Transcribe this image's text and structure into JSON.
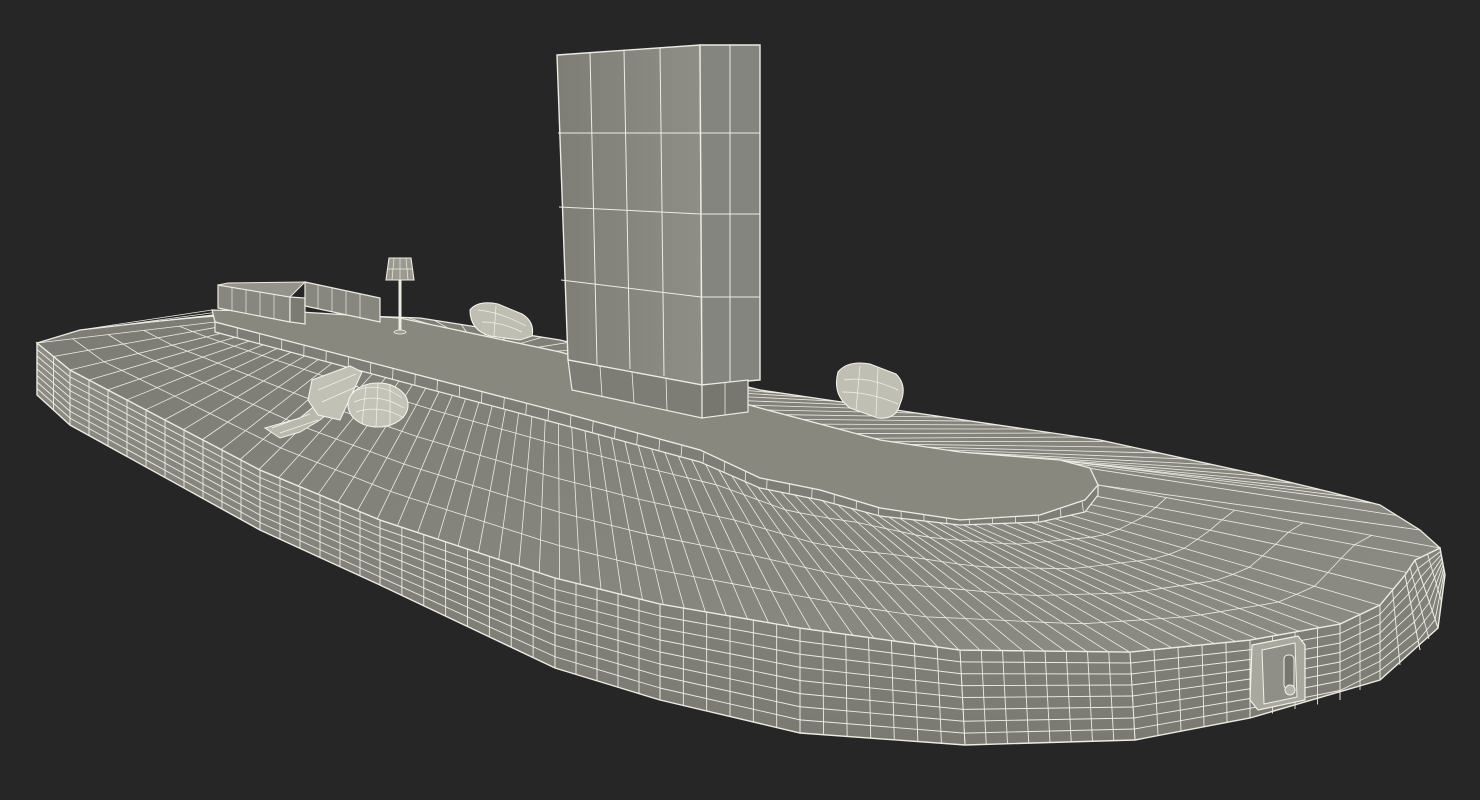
{
  "scene": {
    "subject": "baggage-carousel-wireframe",
    "render_style": "clay-wireframe",
    "colors": {
      "background": "#262626",
      "surface": "#8f8f86",
      "surface_light": "#a2a298",
      "surface_dark": "#76766e",
      "wire": "#ecece4",
      "highlight": "#f2f2ea"
    },
    "objects": [
      "outer-carousel-wall",
      "conveyor-plates",
      "inner-island",
      "info-display-panel",
      "rear-barrier",
      "lamp-post",
      "bag-on-belt-left",
      "bag-on-belt-center",
      "bag-on-belt-right",
      "emergency-stop-box"
    ]
  }
}
